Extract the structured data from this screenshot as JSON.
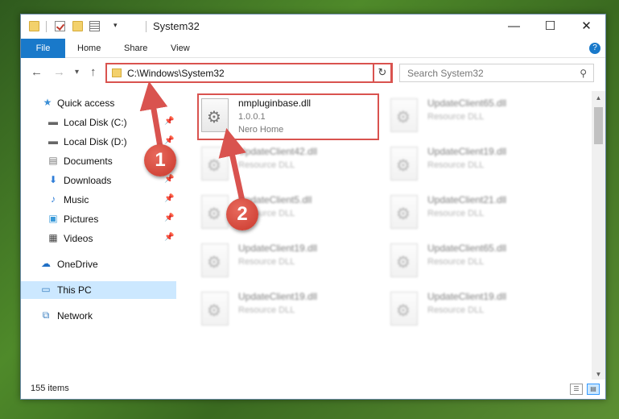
{
  "window": {
    "title": "System32",
    "dropdown_glyph": "▾",
    "minimize": "—",
    "maximize": "☐",
    "close": "✕"
  },
  "ribbon": {
    "tabs": [
      "File",
      "Home",
      "Share",
      "View"
    ],
    "help": "?"
  },
  "nav": {
    "back": "←",
    "forward": "→",
    "recent": "▾",
    "up": "↑",
    "address": "C:\\Windows\\System32",
    "address_dropdown": "⌄",
    "refresh": "↻",
    "search_placeholder": "Search System32",
    "search_icon": "⚲"
  },
  "sidebar": {
    "items": [
      {
        "label": "Quick access",
        "icon": "star-icon",
        "glyph": "★",
        "color": "#3b8fd6",
        "pinned": false
      },
      {
        "label": "Local Disk (C:)",
        "icon": "drive-icon",
        "glyph": "▬",
        "color": "#666666",
        "pinned": true
      },
      {
        "label": "Local Disk (D:)",
        "icon": "drive-icon",
        "glyph": "▬",
        "color": "#666666",
        "pinned": true
      },
      {
        "label": "Documents",
        "icon": "documents-icon",
        "glyph": "▤",
        "color": "#7a7a7a",
        "pinned": true
      },
      {
        "label": "Downloads",
        "icon": "download-icon",
        "glyph": "⬇",
        "color": "#2f7ed8",
        "pinned": true
      },
      {
        "label": "Music",
        "icon": "music-icon",
        "glyph": "♪",
        "color": "#2f7ed8",
        "pinned": true
      },
      {
        "label": "Pictures",
        "icon": "pictures-icon",
        "glyph": "▣",
        "color": "#3a9ad9",
        "pinned": true
      },
      {
        "label": "Videos",
        "icon": "videos-icon",
        "glyph": "▦",
        "color": "#444444",
        "pinned": true
      },
      {
        "label": "OneDrive",
        "icon": "cloud-icon",
        "glyph": "☁",
        "color": "#1f6fc5",
        "pinned": false
      },
      {
        "label": "This PC",
        "icon": "computer-icon",
        "glyph": "▭",
        "color": "#3a7fc0",
        "pinned": false,
        "selected": true
      },
      {
        "label": "Network",
        "icon": "network-icon",
        "glyph": "⧉",
        "color": "#3a7fc0",
        "pinned": false
      }
    ],
    "pin_glyph": "📌"
  },
  "files": [
    {
      "name": "nmpluginbase.dll",
      "line2": "1.0.0.1",
      "line3": "Nero Home",
      "blurred": false
    },
    {
      "name": "UpdateClient65.dll",
      "line2": "Resource DLL",
      "line3": "",
      "blurred": true
    },
    {
      "name": "UpdateClient42.dll",
      "line2": "Resource DLL",
      "line3": "",
      "blurred": true
    },
    {
      "name": "UpdateClient19.dll",
      "line2": "Resource DLL",
      "line3": "",
      "blurred": true
    },
    {
      "name": "UpdateClient5.dll",
      "line2": "Resource DLL",
      "line3": "",
      "blurred": true
    },
    {
      "name": "UpdateClient21.dll",
      "line2": "Resource DLL",
      "line3": "",
      "blurred": true
    },
    {
      "name": "UpdateClient19.dll",
      "line2": "Resource DLL",
      "line3": "",
      "blurred": true
    },
    {
      "name": "UpdateClient65.dll",
      "line2": "Resource DLL",
      "line3": "",
      "blurred": true
    },
    {
      "name": "UpdateClient19.dll",
      "line2": "Resource DLL",
      "line3": "",
      "blurred": true
    },
    {
      "name": "UpdateClient19.dll",
      "line2": "Resource DLL",
      "line3": "",
      "blurred": true
    }
  ],
  "status": {
    "item_count": "155 items"
  },
  "annotations": {
    "badge1": "1",
    "badge2": "2",
    "color": "#d9534f"
  }
}
